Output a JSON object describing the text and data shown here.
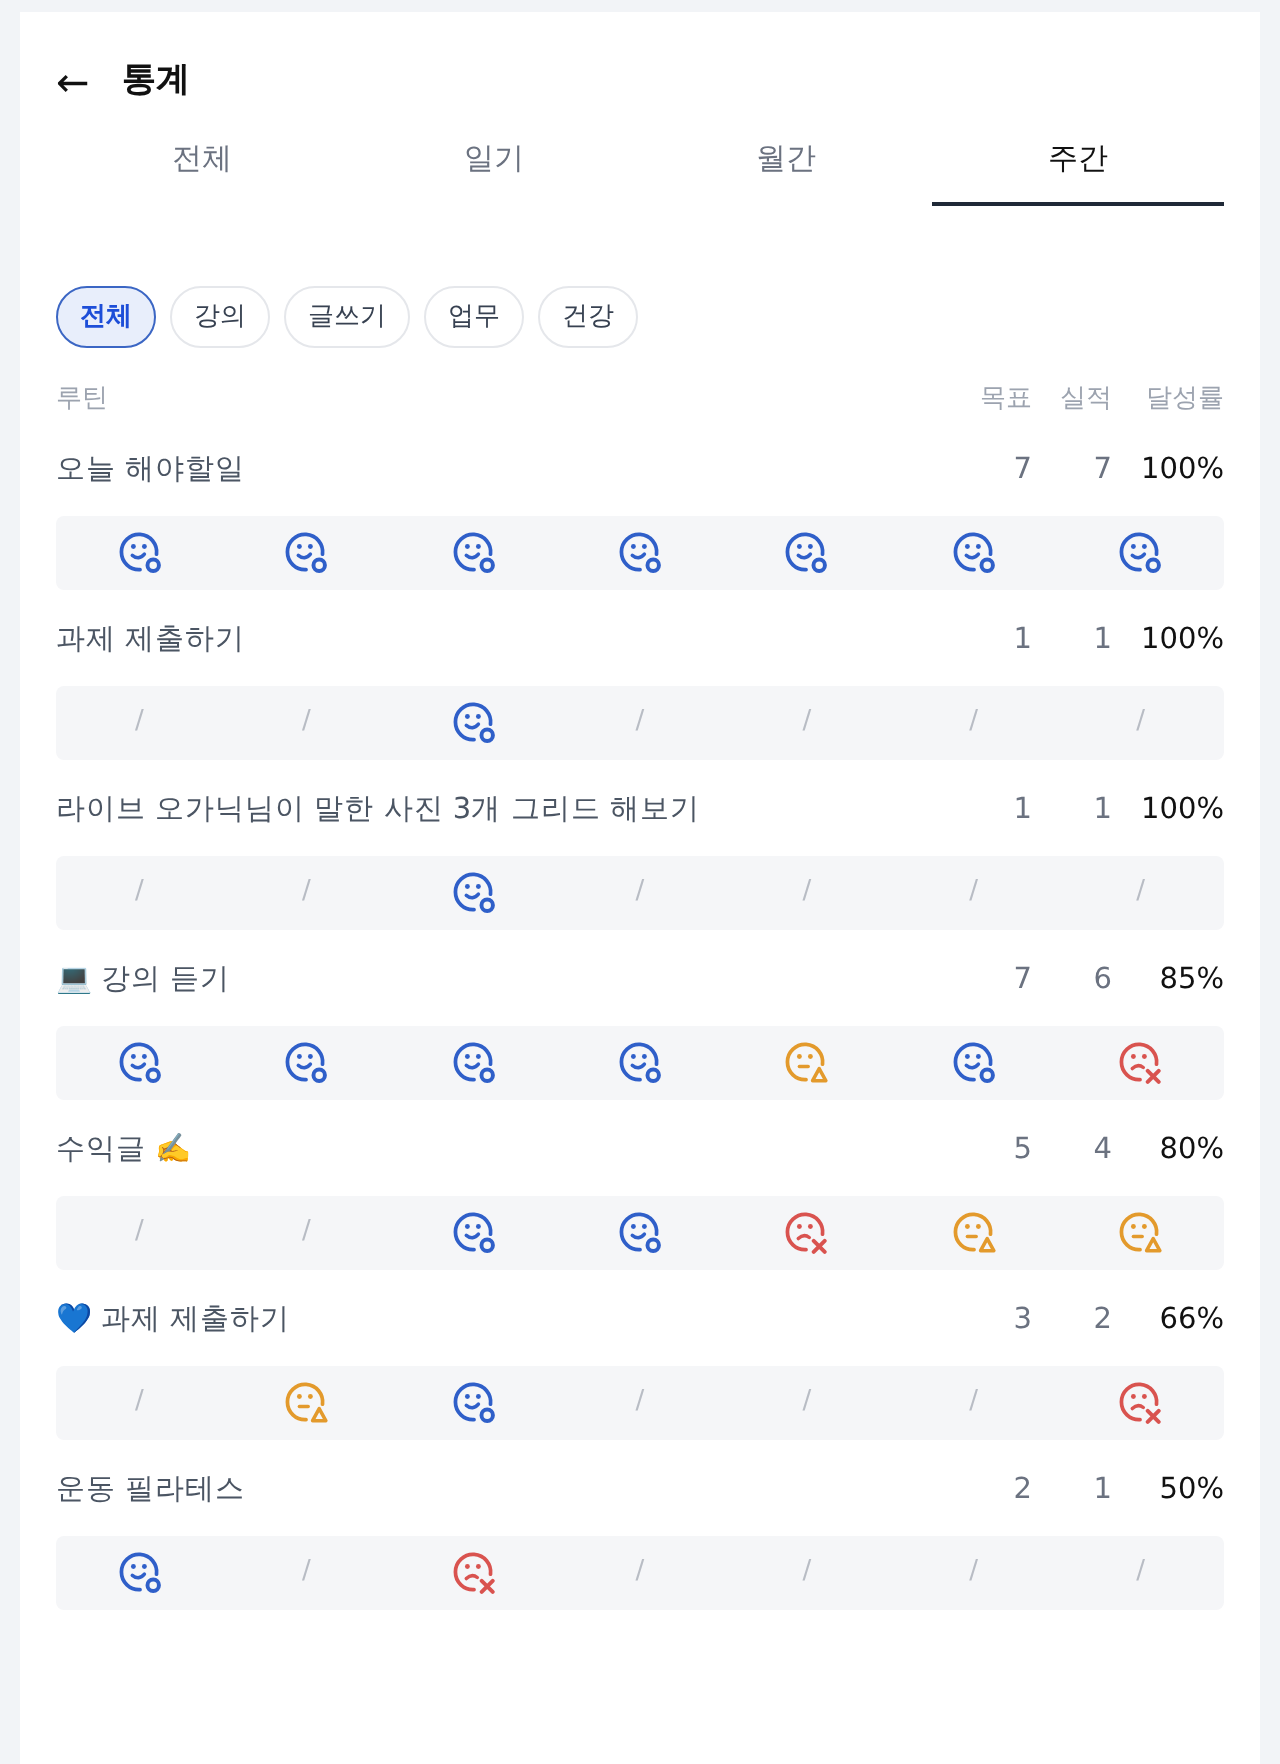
{
  "header": {
    "back": "←",
    "title": "통계"
  },
  "tabs": [
    {
      "label": "전체",
      "selected": false
    },
    {
      "label": "일기",
      "selected": false
    },
    {
      "label": "월간",
      "selected": false
    },
    {
      "label": "주간",
      "selected": true
    }
  ],
  "filters": [
    {
      "label": "전체",
      "selected": true
    },
    {
      "label": "강의",
      "selected": false
    },
    {
      "label": "글쓰기",
      "selected": false
    },
    {
      "label": "업무",
      "selected": false
    },
    {
      "label": "건강",
      "selected": false
    }
  ],
  "columns": {
    "routine": "루틴",
    "goal": "목표",
    "actual": "실적",
    "rate": "달성률"
  },
  "routines": [
    {
      "name": "오늘 해야할일",
      "goal": "7",
      "actual": "7",
      "rate": "100%",
      "days": [
        {
          "kind": "done"
        },
        {
          "kind": "done"
        },
        {
          "kind": "done"
        },
        {
          "kind": "done"
        },
        {
          "kind": "done"
        },
        {
          "kind": "done"
        },
        {
          "kind": "done"
        }
      ]
    },
    {
      "name": "과제 제출하기",
      "goal": "1",
      "actual": "1",
      "rate": "100%",
      "days": [
        {
          "kind": "none",
          "text": "/"
        },
        {
          "kind": "none",
          "text": "/"
        },
        {
          "kind": "done"
        },
        {
          "kind": "none",
          "text": "/"
        },
        {
          "kind": "none",
          "text": "/"
        },
        {
          "kind": "none",
          "text": "/"
        },
        {
          "kind": "none",
          "text": "/"
        }
      ]
    },
    {
      "name": "라이브 오가닉님이 말한 사진 3개 그리드 해보기",
      "goal": "1",
      "actual": "1",
      "rate": "100%",
      "days": [
        {
          "kind": "none",
          "text": "/"
        },
        {
          "kind": "none",
          "text": "/"
        },
        {
          "kind": "done"
        },
        {
          "kind": "none",
          "text": "/"
        },
        {
          "kind": "none",
          "text": "/"
        },
        {
          "kind": "none",
          "text": "/"
        },
        {
          "kind": "none",
          "text": "/"
        }
      ]
    },
    {
      "name": "💻 강의 듣기",
      "goal": "7",
      "actual": "6",
      "rate": "85%",
      "days": [
        {
          "kind": "done"
        },
        {
          "kind": "done"
        },
        {
          "kind": "done"
        },
        {
          "kind": "done"
        },
        {
          "kind": "partial"
        },
        {
          "kind": "done"
        },
        {
          "kind": "fail"
        }
      ]
    },
    {
      "name": "수익글 ✍️",
      "goal": "5",
      "actual": "4",
      "rate": "80%",
      "days": [
        {
          "kind": "none",
          "text": "/"
        },
        {
          "kind": "none",
          "text": "/"
        },
        {
          "kind": "done"
        },
        {
          "kind": "done"
        },
        {
          "kind": "fail"
        },
        {
          "kind": "partial"
        },
        {
          "kind": "partial"
        }
      ]
    },
    {
      "name": "💙 과제 제출하기",
      "goal": "3",
      "actual": "2",
      "rate": "66%",
      "days": [
        {
          "kind": "none",
          "text": "/"
        },
        {
          "kind": "partial"
        },
        {
          "kind": "done"
        },
        {
          "kind": "none",
          "text": "/"
        },
        {
          "kind": "none",
          "text": "/"
        },
        {
          "kind": "none",
          "text": "/"
        },
        {
          "kind": "fail"
        }
      ]
    },
    {
      "name": "운동 필라테스",
      "goal": "2",
      "actual": "1",
      "rate": "50%",
      "days": [
        {
          "kind": "done"
        },
        {
          "kind": "none",
          "text": "/"
        },
        {
          "kind": "fail"
        },
        {
          "kind": "none",
          "text": "/"
        },
        {
          "kind": "none",
          "text": "/"
        },
        {
          "kind": "none",
          "text": "/"
        },
        {
          "kind": "none",
          "text": "/"
        }
      ]
    }
  ]
}
